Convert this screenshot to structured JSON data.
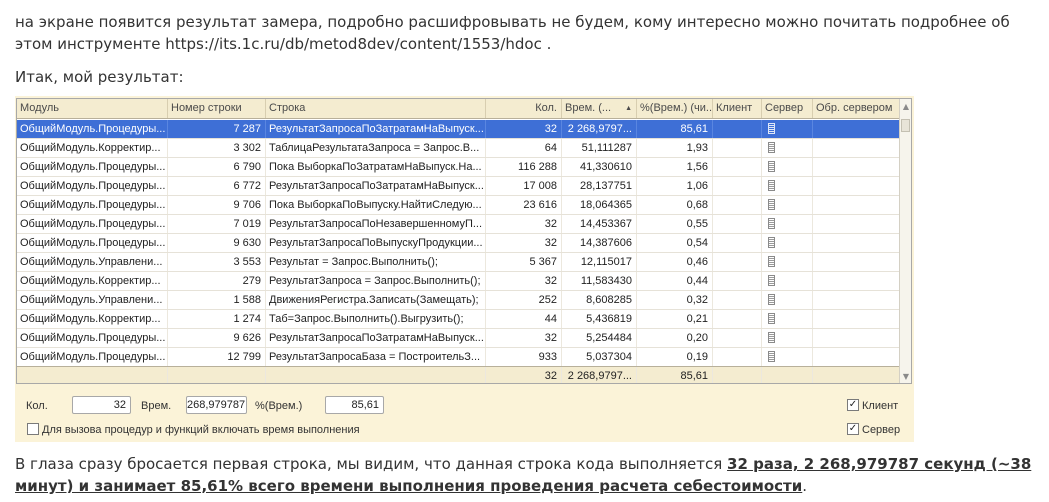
{
  "article": {
    "p1": "на экране появится результат замера, подробно расшифровывать не будем, кому интересно можно почитать подробнее об этом инструменте https://its.1c.ru/db/metod8dev/content/1553/hdoc .",
    "p2": "Итак, мой результат:",
    "p3_before": "В глаза сразу бросается первая строка, мы видим, что данная строка кода выполняется ",
    "p3_bold": "32 раза, 2 268,979787 секунд (~38 минут) и занимает 85,61% всего времени выполнения проведения расчета себестоимости",
    "p3_after": "."
  },
  "table": {
    "columns": [
      "Модуль",
      "Номер строки",
      "Строка",
      "Кол.",
      "Врем. (...",
      "%(Врем.) (чи...",
      "Клиент",
      "Сервер",
      "Обр. сервером"
    ],
    "sort_icon": "sort-ascending-icon",
    "rows": [
      {
        "module": "ОбщийМодуль.Процедуры...",
        "line": "7 287",
        "code": "РезультатЗапросаПоЗатратамНаВыпуск...",
        "count": "32",
        "time": "2 268,9797...",
        "pct": "85,61"
      },
      {
        "module": "ОбщийМодуль.Корректир...",
        "line": "3 302",
        "code": "ТаблицаРезультатаЗапроса = Запрос.В...",
        "count": "64",
        "time": "51,111287",
        "pct": "1,93"
      },
      {
        "module": "ОбщийМодуль.Процедуры...",
        "line": "6 790",
        "code": "Пока ВыборкаПоЗатратамНаВыпуск.На...",
        "count": "116 288",
        "time": "41,330610",
        "pct": "1,56"
      },
      {
        "module": "ОбщийМодуль.Процедуры...",
        "line": "6 772",
        "code": "РезультатЗапросаПоЗатратамНаВыпуск...",
        "count": "17 008",
        "time": "28,137751",
        "pct": "1,06"
      },
      {
        "module": "ОбщийМодуль.Процедуры...",
        "line": "9 706",
        "code": "Пока ВыборкаПоВыпуску.НайтиСледую...",
        "count": "23 616",
        "time": "18,064365",
        "pct": "0,68"
      },
      {
        "module": "ОбщийМодуль.Процедуры...",
        "line": "7 019",
        "code": "РезультатЗапросаПоНезавершенномуП...",
        "count": "32",
        "time": "14,453367",
        "pct": "0,55"
      },
      {
        "module": "ОбщийМодуль.Процедуры...",
        "line": "9 630",
        "code": "РезультатЗапросаПоВыпускуПродукции...",
        "count": "32",
        "time": "14,387606",
        "pct": "0,54"
      },
      {
        "module": "ОбщийМодуль.Управлени...",
        "line": "3 553",
        "code": "Результат = Запрос.Выполнить();",
        "count": "5 367",
        "time": "12,115017",
        "pct": "0,46"
      },
      {
        "module": "ОбщийМодуль.Корректир...",
        "line": "279",
        "code": "РезультатЗапроса = Запрос.Выполнить();",
        "count": "32",
        "time": "11,583430",
        "pct": "0,44"
      },
      {
        "module": "ОбщийМодуль.Управлени...",
        "line": "1 588",
        "code": "ДвиженияРегистра.Записать(Замещать);",
        "count": "252",
        "time": "8,608285",
        "pct": "0,32"
      },
      {
        "module": "ОбщийМодуль.Корректир...",
        "line": "1 274",
        "code": "Таб=Запрос.Выполнить().Выгрузить();",
        "count": "44",
        "time": "5,436819",
        "pct": "0,21"
      },
      {
        "module": "ОбщийМодуль.Процедуры...",
        "line": "9 626",
        "code": "РезультатЗапросаПоЗатратамНаВыпуск...",
        "count": "32",
        "time": "5,254484",
        "pct": "0,20"
      },
      {
        "module": "ОбщийМодуль.Процедуры...",
        "line": "12 799",
        "code": "РезультатЗапросаБаза = ПостроительЗ...",
        "count": "933",
        "time": "5,037304",
        "pct": "0,19"
      }
    ],
    "totals": {
      "count": "32",
      "time": "2 268,9797...",
      "pct": "85,61"
    }
  },
  "panel": {
    "count_label": "Кол.",
    "count_value": "32",
    "time_label": "Врем.",
    "time_value": "268,979787",
    "pct_label": "%(Врем.)",
    "pct_value": "85,61",
    "include_label": "Для вызова процедур и функций включать время выполнения",
    "include_checked": false,
    "client_label": "Клиент",
    "client_checked": true,
    "server_label": "Сервер",
    "server_checked": true
  }
}
